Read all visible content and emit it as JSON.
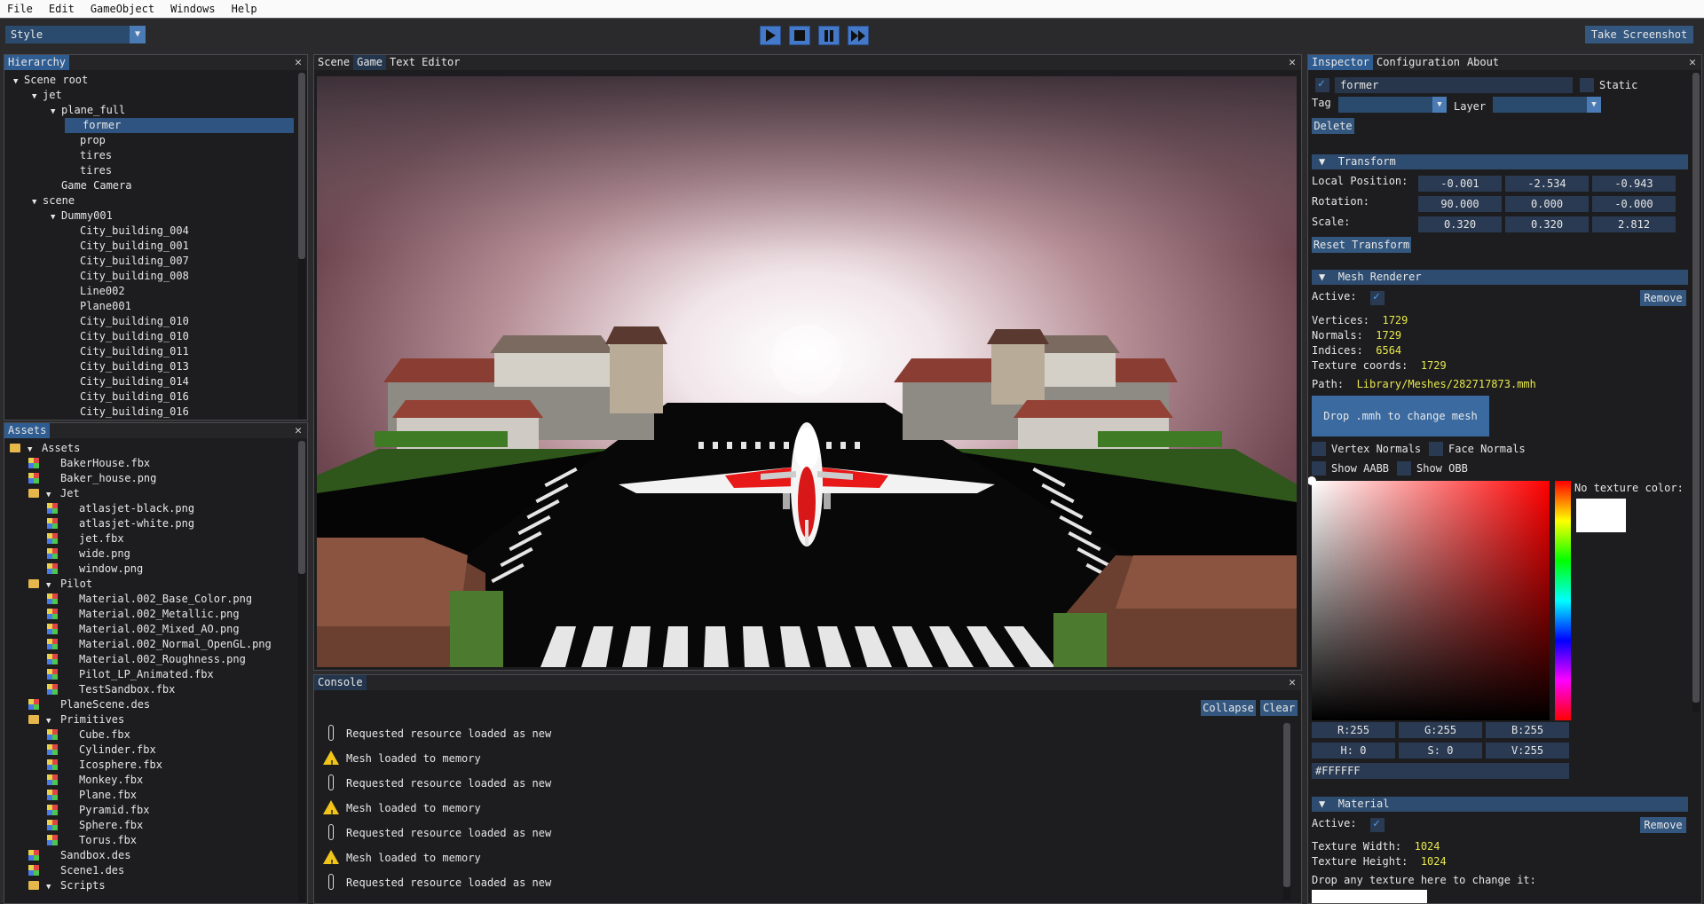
{
  "menu": [
    "File",
    "Edit",
    "GameObject",
    "Windows",
    "Help"
  ],
  "toolbar": {
    "style_label": "Style",
    "screenshot_label": "Take Screenshot"
  },
  "hierarchy": {
    "tab": "Hierarchy",
    "rows": [
      {
        "label": "Scene root",
        "depth": 0,
        "arrow": true
      },
      {
        "label": "jet",
        "depth": 1,
        "arrow": true
      },
      {
        "label": "plane_full",
        "depth": 2,
        "arrow": true
      },
      {
        "label": "former",
        "depth": 3,
        "selected": true
      },
      {
        "label": "prop",
        "depth": 3
      },
      {
        "label": "tires",
        "depth": 3
      },
      {
        "label": "tires",
        "depth": 3
      },
      {
        "label": "Game Camera",
        "depth": 2
      },
      {
        "label": "scene",
        "depth": 1,
        "arrow": true
      },
      {
        "label": "Dummy001",
        "depth": 2,
        "arrow": true
      },
      {
        "label": "City_building_004",
        "depth": 3
      },
      {
        "label": "City_building_001",
        "depth": 3
      },
      {
        "label": "City_building_007",
        "depth": 3
      },
      {
        "label": "City_building_008",
        "depth": 3
      },
      {
        "label": "Line002",
        "depth": 3
      },
      {
        "label": "Plane001",
        "depth": 3
      },
      {
        "label": "City_building_010",
        "depth": 3
      },
      {
        "label": "City_building_010",
        "depth": 3
      },
      {
        "label": "City_building_011",
        "depth": 3
      },
      {
        "label": "City_building_013",
        "depth": 3
      },
      {
        "label": "City_building_014",
        "depth": 3
      },
      {
        "label": "City_building_016",
        "depth": 3
      },
      {
        "label": "City_building_016",
        "depth": 3
      }
    ]
  },
  "assets": {
    "tab": "Assets",
    "rows": [
      {
        "label": "Assets",
        "depth": 0,
        "arrow": true,
        "folder": true
      },
      {
        "label": "BakerHouse.fbx",
        "depth": 1,
        "file": true
      },
      {
        "label": "Baker_house.png",
        "depth": 1,
        "file": true
      },
      {
        "label": "Jet",
        "depth": 1,
        "arrow": true,
        "folder": true
      },
      {
        "label": "atlasjet-black.png",
        "depth": 2,
        "file": true
      },
      {
        "label": "atlasjet-white.png",
        "depth": 2,
        "file": true
      },
      {
        "label": "jet.fbx",
        "depth": 2,
        "file": true
      },
      {
        "label": "wide.png",
        "depth": 2,
        "file": true
      },
      {
        "label": "window.png",
        "depth": 2,
        "file": true
      },
      {
        "label": "Pilot",
        "depth": 1,
        "arrow": true,
        "folder": true
      },
      {
        "label": "Material.002_Base_Color.png",
        "depth": 2,
        "file": true
      },
      {
        "label": "Material.002_Metallic.png",
        "depth": 2,
        "file": true
      },
      {
        "label": "Material.002_Mixed_AO.png",
        "depth": 2,
        "file": true
      },
      {
        "label": "Material.002_Normal_OpenGL.png",
        "depth": 2,
        "file": true
      },
      {
        "label": "Material.002_Roughness.png",
        "depth": 2,
        "file": true
      },
      {
        "label": "Pilot_LP_Animated.fbx",
        "depth": 2,
        "file": true
      },
      {
        "label": "TestSandbox.fbx",
        "depth": 2,
        "file": true
      },
      {
        "label": "PlaneScene.des",
        "depth": 1,
        "file": true
      },
      {
        "label": "Primitives",
        "depth": 1,
        "arrow": true,
        "folder": true
      },
      {
        "label": "Cube.fbx",
        "depth": 2,
        "file": true
      },
      {
        "label": "Cylinder.fbx",
        "depth": 2,
        "file": true
      },
      {
        "label": "Icosphere.fbx",
        "depth": 2,
        "file": true
      },
      {
        "label": "Monkey.fbx",
        "depth": 2,
        "file": true
      },
      {
        "label": "Plane.fbx",
        "depth": 2,
        "file": true
      },
      {
        "label": "Pyramid.fbx",
        "depth": 2,
        "file": true
      },
      {
        "label": "Sphere.fbx",
        "depth": 2,
        "file": true
      },
      {
        "label": "Torus.fbx",
        "depth": 2,
        "file": true
      },
      {
        "label": "Sandbox.des",
        "depth": 1,
        "file": true
      },
      {
        "label": "Scene1.des",
        "depth": 1,
        "file": true
      },
      {
        "label": "Scripts",
        "depth": 1,
        "arrow": true,
        "folder": true
      }
    ]
  },
  "viewport": {
    "tabs": [
      "Scene",
      "Game",
      "Text Editor"
    ],
    "active": "Game"
  },
  "console": {
    "tab": "Console",
    "collapse_label": "Collapse",
    "clear_label": "Clear",
    "logs": [
      {
        "type": "info",
        "text": "Requested resource loaded as new"
      },
      {
        "type": "warn",
        "text": "Mesh loaded to memory"
      },
      {
        "type": "info",
        "text": "Requested resource loaded as new"
      },
      {
        "type": "warn",
        "text": "Mesh loaded to memory"
      },
      {
        "type": "info",
        "text": "Requested resource loaded as new"
      },
      {
        "type": "warn",
        "text": "Mesh loaded to memory"
      },
      {
        "type": "info",
        "text": "Requested resource loaded as new"
      }
    ]
  },
  "inspector": {
    "tabs": [
      "Inspector",
      "Configuration",
      "About"
    ],
    "name": "former",
    "static_label": "Static",
    "tag_label": "Tag",
    "layer_label": "Layer",
    "delete_label": "Delete",
    "transform": {
      "title": "Transform",
      "pos_label": "Local Position:",
      "rot_label": "Rotation:",
      "scale_label": "Scale:",
      "position": [
        "-0.001",
        "-2.534",
        "-0.943"
      ],
      "rotation": [
        "90.000",
        "0.000",
        "-0.000"
      ],
      "scale": [
        "0.320",
        "0.320",
        "2.812"
      ],
      "reset_label": "Reset Transform"
    },
    "mesh": {
      "title": "Mesh Renderer",
      "active_label": "Active:",
      "remove_label": "Remove",
      "vertices_label": "Vertices:",
      "vertices": "1729",
      "normals_label": "Normals:",
      "normals": "1729",
      "indices_label": "Indices:",
      "indices": "6564",
      "texcoords_label": "Texture coords:",
      "texcoords": "1729",
      "path_label": "Path:",
      "path": "Library/Meshes/282717873.mmh",
      "drop_label": "Drop .mmh to change mesh",
      "vertex_normals": "Vertex Normals",
      "face_normals": "Face Normals",
      "show_aabb": "Show AABB",
      "show_obb": "Show OBB",
      "no_tex_label": "No texture color:",
      "r": "R:255",
      "g": "G:255",
      "b": "B:255",
      "h": "H:  0",
      "s": "S:  0",
      "v": "V:255",
      "hex": "#FFFFFF"
    },
    "material": {
      "title": "Material",
      "active_label": "Active:",
      "remove_label": "Remove",
      "tw_label": "Texture Width:",
      "tw": "1024",
      "th_label": "Texture Height:",
      "th": "1024",
      "drop_label": "Drop any texture here to change it:"
    }
  },
  "colors": {
    "accent": "#2f5c91",
    "warn": "#f0c419",
    "value": "#e8e84d",
    "play": "#4479c9"
  }
}
